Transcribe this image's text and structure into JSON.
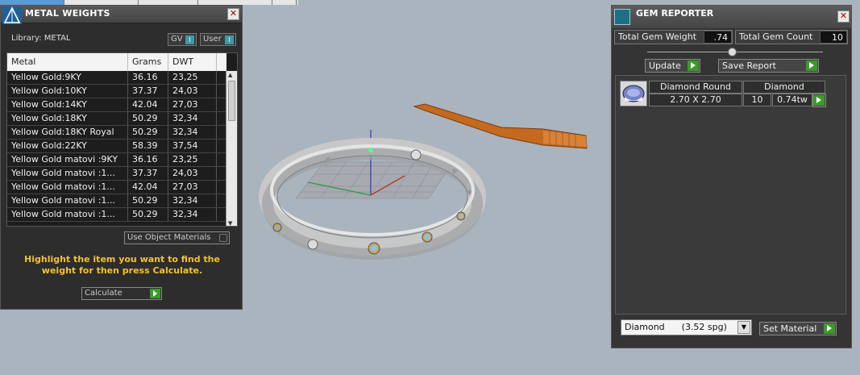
{
  "metal_weights": {
    "title": "METAL WEIGHTS",
    "library_label": "Library: METAL",
    "gv_label": "GV",
    "user_label": "User",
    "columns": [
      "Metal",
      "Grams",
      "DWT"
    ],
    "rows": [
      {
        "metal": "Yellow Gold:9KY",
        "grams": "36.16",
        "dwt": "23,25"
      },
      {
        "metal": "Yellow Gold:10KY",
        "grams": "37.37",
        "dwt": "24,03"
      },
      {
        "metal": "Yellow Gold:14KY",
        "grams": "42.04",
        "dwt": "27,03"
      },
      {
        "metal": "Yellow Gold:18KY",
        "grams": "50.29",
        "dwt": "32,34"
      },
      {
        "metal": "Yellow Gold:18KY Royal",
        "grams": "50.29",
        "dwt": "32,34"
      },
      {
        "metal": "Yellow Gold:22KY",
        "grams": "58.39",
        "dwt": "37,54"
      },
      {
        "metal": "Yellow Gold matovi :9KY",
        "grams": "36.16",
        "dwt": "23,25"
      },
      {
        "metal": "Yellow Gold matovi :1...",
        "grams": "37.37",
        "dwt": "24,03"
      },
      {
        "metal": "Yellow Gold matovi :1...",
        "grams": "42.04",
        "dwt": "27,03"
      },
      {
        "metal": "Yellow Gold matovi :1...",
        "grams": "50.29",
        "dwt": "32,34"
      },
      {
        "metal": "Yellow Gold matovi :1...",
        "grams": "50.29",
        "dwt": "32,34"
      }
    ],
    "use_object_materials": "Use Object Materials",
    "hint": "Highlight the item you want to find the weight for then press Calculate.",
    "calculate_label": "Calculate"
  },
  "gem_reporter": {
    "title": "GEM REPORTER",
    "total_gem_weight_label": "Total Gem Weight",
    "total_gem_weight_value": ".74",
    "total_gem_count_label": "Total Gem Count",
    "total_gem_count_value": "10",
    "update_label": "Update",
    "save_report_label": "Save Report",
    "gem": {
      "shape": "Diamond Round",
      "size": "2.70 X 2.70",
      "material": "Diamond",
      "count": "10",
      "weight": "0.74tw"
    },
    "material_select": "Diamond      (3.52 spg)",
    "set_material_label": "Set Material"
  },
  "colors": {
    "panel_bg": "#2d2d2d",
    "viewport_bg": "#aab4be",
    "go_green": "#3b9a2a",
    "hint_yellow": "#f2c230",
    "ring_silver": "#c8c8c8",
    "tool_orange": "#c46a1f"
  }
}
